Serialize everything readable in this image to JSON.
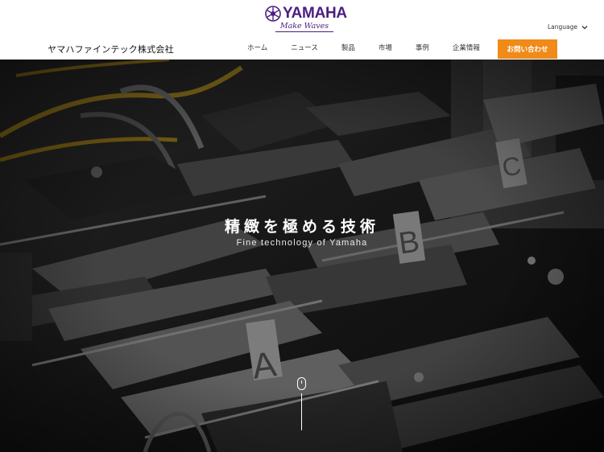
{
  "brand": {
    "logo_word": "YAMAHA",
    "logo_tagline": "Make Waves",
    "company_name": "ヤマハファインテック株式会社",
    "accent_color": "#4b1e80"
  },
  "language": {
    "label": "Language",
    "icon": "chevron-down-icon"
  },
  "nav": {
    "items": [
      {
        "label": "ホーム"
      },
      {
        "label": "ニュース"
      },
      {
        "label": "製品"
      },
      {
        "label": "市場"
      },
      {
        "label": "事例"
      },
      {
        "label": "企業情報"
      }
    ]
  },
  "cta": {
    "label": "お問い合わせ",
    "color": "#f08a19"
  },
  "hero": {
    "title": "精緻を極める技術",
    "subtitle": "Fine technology of Yamaha",
    "scroll_icon": "mouse-scroll-icon",
    "machine_labels": [
      "A",
      "B",
      "C"
    ]
  }
}
